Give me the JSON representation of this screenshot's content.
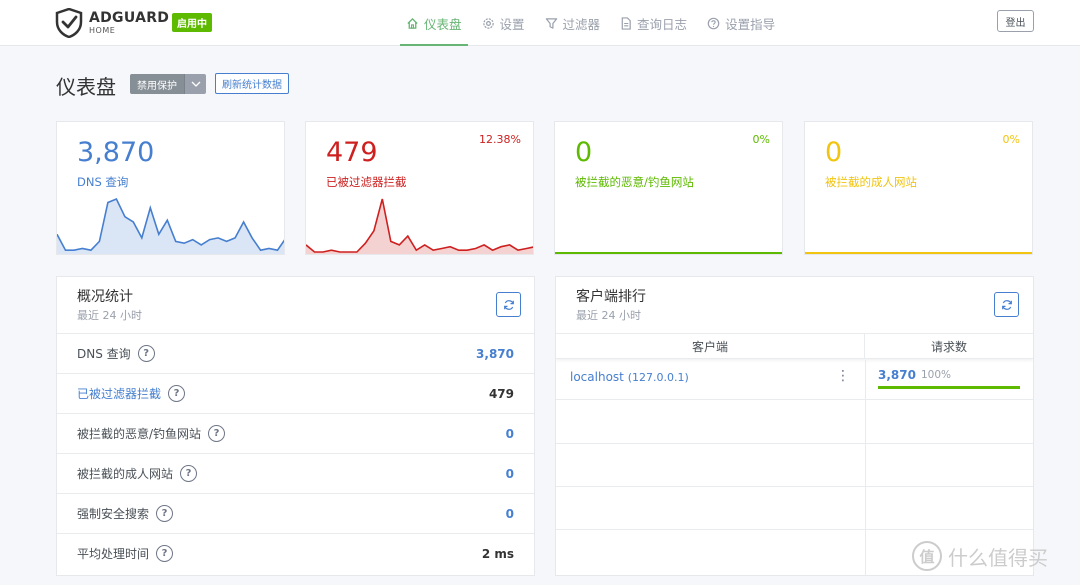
{
  "header": {
    "brand_main": "ADGUARD",
    "brand_sub": "HOME",
    "status_badge": "启用中",
    "nav": [
      {
        "label": "仪表盘",
        "icon": "home-icon",
        "active": true
      },
      {
        "label": "设置",
        "icon": "gear-icon",
        "active": false
      },
      {
        "label": "过滤器",
        "icon": "filter-icon",
        "active": false
      },
      {
        "label": "查询日志",
        "icon": "document-icon",
        "active": false
      },
      {
        "label": "设置指导",
        "icon": "help-circle-icon",
        "active": false
      }
    ],
    "logout_label": "登出"
  },
  "page": {
    "title": "仪表盘",
    "disable_button": "禁用保护",
    "refresh_button": "刷新统计数据"
  },
  "stats": [
    {
      "value": "3,870",
      "label": "DNS 查询",
      "percent": "",
      "color": "#467fcf",
      "spark": [
        10,
        1,
        1,
        2,
        1,
        6,
        28,
        30,
        20,
        17,
        8,
        25,
        10,
        18,
        6,
        5,
        7,
        4,
        7,
        8,
        6,
        8,
        17,
        8,
        1,
        2,
        1,
        8
      ]
    },
    {
      "value": "479",
      "label": "已被过滤器拦截",
      "percent": "12.38%",
      "color": "#cd201f",
      "spark": [
        4,
        0,
        0,
        1,
        0,
        0,
        0,
        5,
        12,
        30,
        6,
        4,
        9,
        1,
        4,
        1,
        2,
        3,
        1,
        1,
        2,
        4,
        1,
        3,
        4,
        1,
        2,
        3
      ]
    },
    {
      "value": "0",
      "label": "被拦截的恶意/钓鱼网站",
      "percent": "0%",
      "color": "#5eba00",
      "spark": []
    },
    {
      "value": "0",
      "label": "被拦截的成人网站",
      "percent": "0%",
      "color": "#f1c40f",
      "spark": []
    }
  ],
  "overview": {
    "title": "概况统计",
    "subtitle": "最近 24 小时",
    "rows": [
      {
        "label": "DNS 查询",
        "value": "3,870",
        "link": false
      },
      {
        "label": "已被过滤器拦截",
        "value": "479",
        "link": true
      },
      {
        "label": "被拦截的恶意/钓鱼网站",
        "value": "0",
        "link": false
      },
      {
        "label": "被拦截的成人网站",
        "value": "0",
        "link": false
      },
      {
        "label": "强制安全搜索",
        "value": "0",
        "link": false
      },
      {
        "label": "平均处理时间",
        "value": "2 ms",
        "link": false
      }
    ]
  },
  "clients": {
    "title": "客户端排行",
    "subtitle": "最近 24 小时",
    "col_client": "客户端",
    "col_requests": "请求数",
    "rows": [
      {
        "name": "localhost",
        "ip": "(127.0.0.1)",
        "count": "3,870",
        "percent": "100%",
        "fraction": 1.0
      }
    ]
  },
  "watermark": {
    "glyph": "值",
    "text": "什么值得买"
  }
}
